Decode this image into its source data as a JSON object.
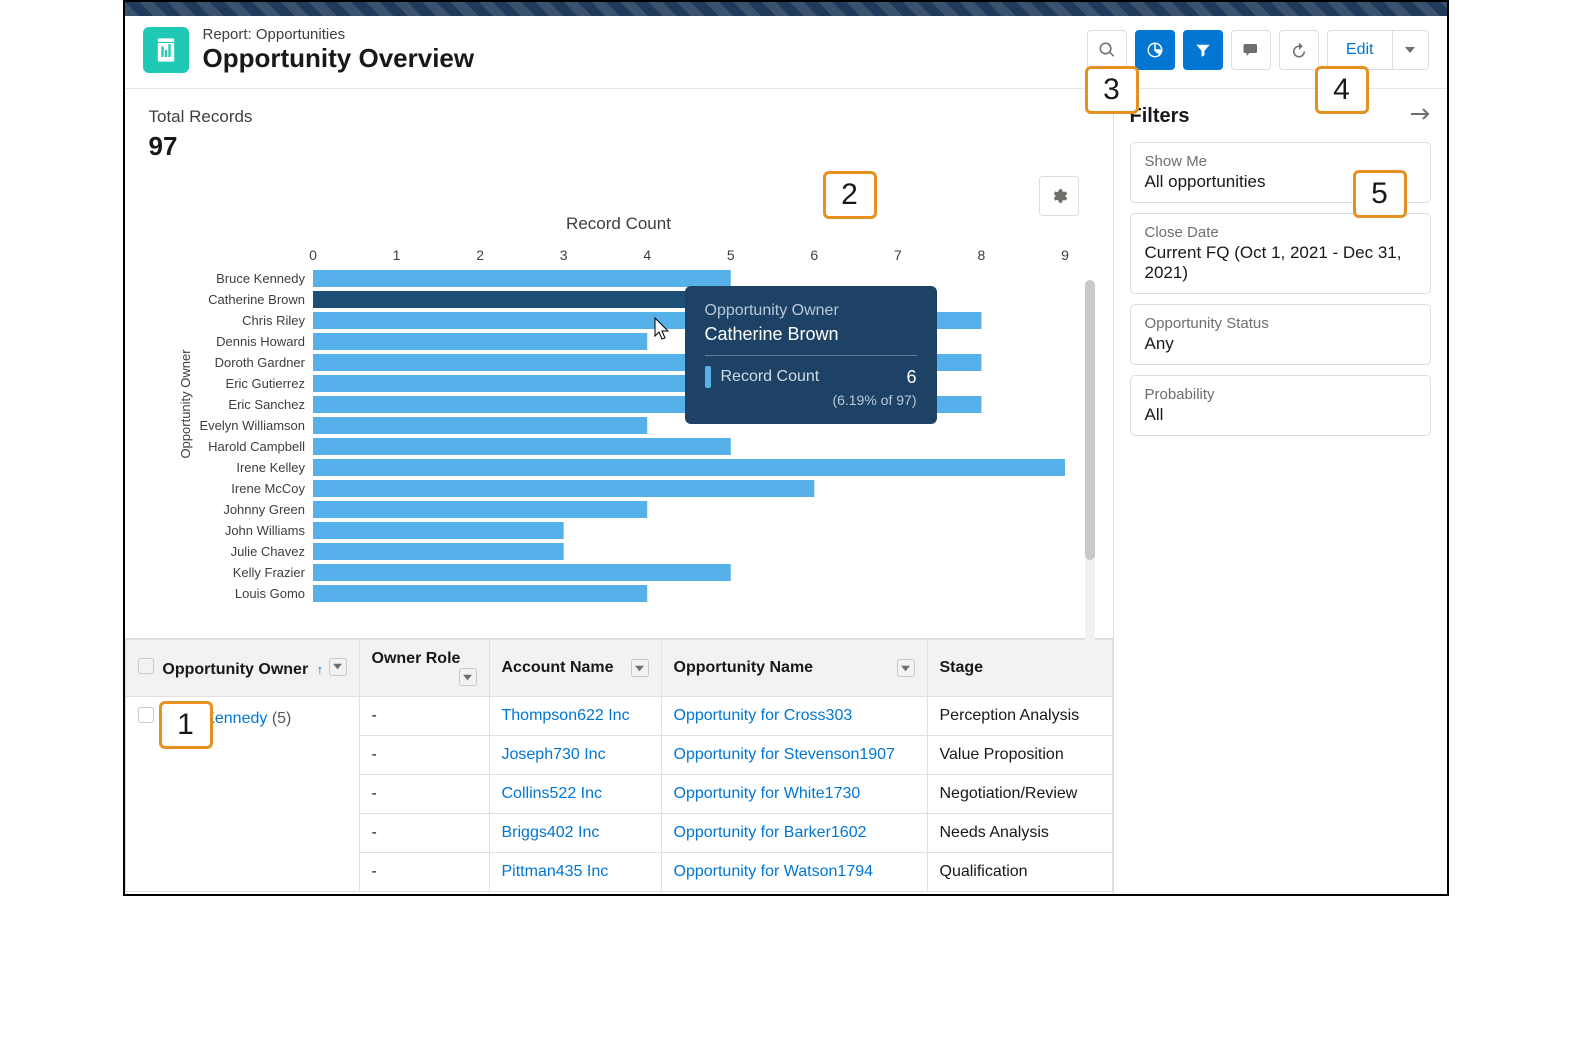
{
  "header": {
    "subtitle": "Report: Opportunities",
    "title": "Opportunity Overview",
    "edit_label": "Edit"
  },
  "totals": {
    "label": "Total Records",
    "value": "97"
  },
  "chart_data": {
    "type": "bar",
    "orientation": "horizontal",
    "title": "Record Count",
    "ylabel": "Opportunity Owner",
    "xlim": [
      0,
      9
    ],
    "x_ticks": [
      0,
      1,
      2,
      3,
      4,
      5,
      6,
      7,
      8,
      9
    ],
    "categories": [
      "Bruce Kennedy",
      "Catherine Brown",
      "Chris Riley",
      "Dennis Howard",
      "Doroth Gardner",
      "Eric Gutierrez",
      "Eric Sanchez",
      "Evelyn Williamson",
      "Harold Campbell",
      "Irene Kelley",
      "Irene McCoy",
      "Johnny Green",
      "John Williams",
      "Julie Chavez",
      "Kelly Frazier",
      "Louis Gomo"
    ],
    "values": [
      5,
      6,
      8,
      4,
      8,
      7,
      8,
      4,
      5,
      9,
      6,
      4,
      3,
      3,
      5,
      4
    ],
    "highlight_index": 1,
    "highlighted": {
      "owner": "Catherine Brown",
      "count": 6,
      "percent": "(6.19% of 97)"
    }
  },
  "tooltip": {
    "owner_label": "Opportunity Owner",
    "owner_value": "Catherine Brown",
    "metric_label": "Record Count",
    "metric_value": "6",
    "percent": "(6.19% of 97)"
  },
  "table": {
    "columns": [
      "Opportunity Owner",
      "Owner Role",
      "Account Name",
      "Opportunity Name",
      "Stage"
    ],
    "group_owner": "Bruce Kennedy",
    "group_count": "(5)",
    "rows": [
      {
        "role": "-",
        "account": "Thompson622 Inc",
        "opp": "Opportunity for Cross303",
        "stage": "Perception Analysis"
      },
      {
        "role": "-",
        "account": "Joseph730 Inc",
        "opp": "Opportunity for Stevenson1907",
        "stage": "Value Proposition"
      },
      {
        "role": "-",
        "account": "Collins522 Inc",
        "opp": "Opportunity for White1730",
        "stage": "Negotiation/Review"
      },
      {
        "role": "-",
        "account": "Briggs402 Inc",
        "opp": "Opportunity for Barker1602",
        "stage": "Needs Analysis"
      },
      {
        "role": "-",
        "account": "Pittman435 Inc",
        "opp": "Opportunity for Watson1794",
        "stage": "Qualification"
      }
    ]
  },
  "filters": {
    "heading": "Filters",
    "items": [
      {
        "label": "Show Me",
        "value": "All opportunities"
      },
      {
        "label": "Close Date",
        "value": "Current FQ (Oct 1, 2021 - Dec 31, 2021)"
      },
      {
        "label": "Opportunity Status",
        "value": "Any"
      },
      {
        "label": "Probability",
        "value": "All"
      }
    ]
  },
  "callouts": {
    "c1": "1",
    "c2": "2",
    "c3": "3",
    "c4": "4",
    "c5": "5"
  }
}
